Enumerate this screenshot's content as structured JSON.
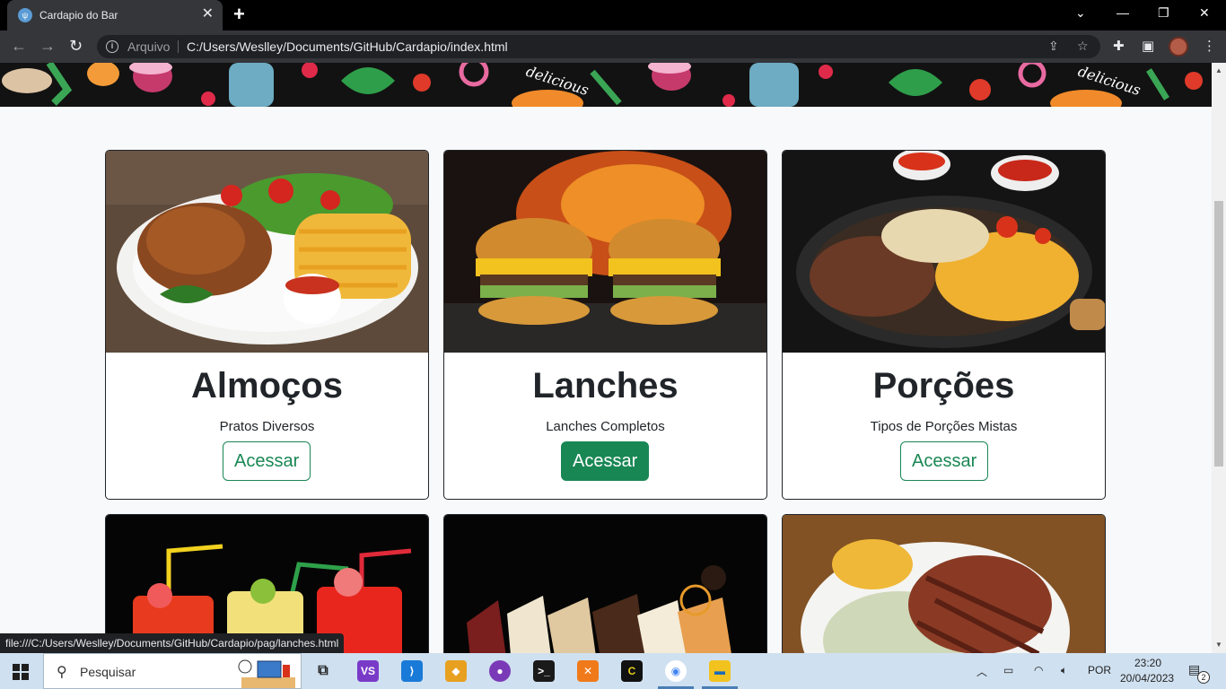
{
  "browser": {
    "tab_title": "Cardapio do Bar",
    "tab_favicon": "utensils-icon",
    "scheme_label": "Arquivo",
    "url": "C:/Users/Weslley/Documents/GitHub/Cardapio/index.html",
    "status_url": "file:///C:/Users/Weslley/Documents/GitHub/Cardapio/pag/lanches.html"
  },
  "banner": {
    "text_left": "delicious",
    "text_right": "delicious"
  },
  "cards": [
    {
      "title": "Almoços",
      "text": "Pratos Diversos",
      "button": "Acessar",
      "image": "roast-chicken-fries-plate"
    },
    {
      "title": "Lanches",
      "text": "Lanches Completos",
      "button": "Acessar",
      "image": "burgers-flames"
    },
    {
      "title": "Porções",
      "text": "Tipos de Porções Mistas",
      "button": "Acessar",
      "image": "meat-potato-skillet"
    },
    {
      "title": "",
      "text": "",
      "button": "",
      "image": "colorful-drinks-straws"
    },
    {
      "title": "",
      "text": "",
      "button": "",
      "image": "cake-slices"
    },
    {
      "title": "",
      "text": "",
      "button": "",
      "image": "steak-rice-bowl"
    }
  ],
  "taskbar": {
    "search_placeholder": "Pesquisar",
    "language": "POR",
    "time": "23:20",
    "date": "20/04/2023",
    "notifications": "2"
  },
  "colors": {
    "accent": "#198754",
    "browser_dark": "#35363a"
  }
}
